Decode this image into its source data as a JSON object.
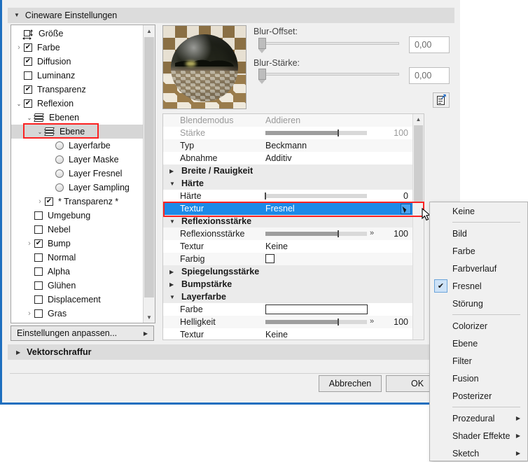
{
  "section": {
    "title": "Cineware Einstellungen",
    "title2": "Vektorschraffur"
  },
  "tree": {
    "items": [
      {
        "label": "Größe",
        "kind": "icon-size",
        "indent": 0,
        "twisty": "none",
        "checked": null
      },
      {
        "label": "Farbe",
        "kind": "checkbox",
        "indent": 0,
        "twisty": "closed",
        "checked": true
      },
      {
        "label": "Diffusion",
        "kind": "checkbox",
        "indent": 0,
        "twisty": "none",
        "checked": true
      },
      {
        "label": "Luminanz",
        "kind": "checkbox",
        "indent": 0,
        "twisty": "none",
        "checked": false
      },
      {
        "label": "Transparenz",
        "kind": "checkbox",
        "indent": 0,
        "twisty": "none",
        "checked": true
      },
      {
        "label": "Reflexion",
        "kind": "checkbox",
        "indent": 0,
        "twisty": "open",
        "checked": true
      },
      {
        "label": "Ebenen",
        "kind": "layers",
        "indent": 1,
        "twisty": "open",
        "checked": null
      },
      {
        "label": "Ebene",
        "kind": "layers",
        "indent": 2,
        "twisty": "open",
        "checked": null,
        "selected": true,
        "highlight": true
      },
      {
        "label": "Layerfarbe",
        "kind": "radio",
        "indent": 3,
        "twisty": "none",
        "checked": null
      },
      {
        "label": "Layer Maske",
        "kind": "radio",
        "indent": 3,
        "twisty": "none",
        "checked": null
      },
      {
        "label": "Layer Fresnel",
        "kind": "radio",
        "indent": 3,
        "twisty": "none",
        "checked": null
      },
      {
        "label": "Layer Sampling",
        "kind": "radio",
        "indent": 3,
        "twisty": "none",
        "checked": null
      },
      {
        "label": "* Transparenz *",
        "kind": "checkbox",
        "indent": 2,
        "twisty": "closed",
        "checked": true
      },
      {
        "label": "Umgebung",
        "kind": "checkbox",
        "indent": 1,
        "twisty": "none",
        "checked": false
      },
      {
        "label": "Nebel",
        "kind": "checkbox",
        "indent": 1,
        "twisty": "none",
        "checked": false
      },
      {
        "label": "Bump",
        "kind": "checkbox",
        "indent": 1,
        "twisty": "closed",
        "checked": true
      },
      {
        "label": "Normal",
        "kind": "checkbox",
        "indent": 1,
        "twisty": "none",
        "checked": false
      },
      {
        "label": "Alpha",
        "kind": "checkbox",
        "indent": 1,
        "twisty": "none",
        "checked": false
      },
      {
        "label": "Glühen",
        "kind": "checkbox",
        "indent": 1,
        "twisty": "none",
        "checked": false
      },
      {
        "label": "Displacement",
        "kind": "checkbox",
        "indent": 1,
        "twisty": "none",
        "checked": false
      },
      {
        "label": "Gras",
        "kind": "checkbox",
        "indent": 1,
        "twisty": "closed",
        "checked": false
      }
    ],
    "adjust_button": "Einstellungen anpassen..."
  },
  "preview": {
    "blur_offset_label": "Blur-Offset:",
    "blur_offset_value": "0,00",
    "blur_strength_label": "Blur-Stärke:",
    "blur_strength_value": "0,00"
  },
  "properties": {
    "rows": [
      {
        "name": "Blendemodus",
        "value": "Addieren",
        "type": "text",
        "style": "dim-alt"
      },
      {
        "name": "Stärke",
        "value": "",
        "type": "slider",
        "num": "100",
        "fill": 72,
        "style": "dim",
        "knob": true
      },
      {
        "name": "Typ",
        "value": "Beckmann",
        "type": "text",
        "style": "alt"
      },
      {
        "name": "Abnahme",
        "value": "Additiv",
        "type": "text",
        "style": "normal"
      },
      {
        "name": "Breite / Rauigkeit",
        "value": "",
        "type": "group",
        "twisty": "closed"
      },
      {
        "name": "Härte",
        "value": "",
        "type": "group",
        "twisty": "open"
      },
      {
        "name": "Härte",
        "value": "",
        "type": "slider",
        "num": "0",
        "fill": 0,
        "style": "normal",
        "knob": true
      },
      {
        "name": "Textur",
        "value": "Fresnel",
        "type": "text",
        "style": "selected",
        "dropdown": true
      },
      {
        "name": "Reflexionsstärke",
        "value": "",
        "type": "group",
        "twisty": "open"
      },
      {
        "name": "Reflexionsstärke",
        "value": "",
        "type": "slider",
        "num": "100",
        "fill": 72,
        "style": "alt",
        "knob": true,
        "arrows": true
      },
      {
        "name": "Textur",
        "value": "Keine",
        "type": "text",
        "style": "normal"
      },
      {
        "name": "Farbig",
        "value": "",
        "type": "checkbox",
        "style": "alt",
        "checked": false
      },
      {
        "name": "Spiegelungsstärke",
        "value": "",
        "type": "group",
        "twisty": "closed"
      },
      {
        "name": "Bumpstärke",
        "value": "",
        "type": "group",
        "twisty": "closed"
      },
      {
        "name": "Layerfarbe",
        "value": "",
        "type": "group",
        "twisty": "open"
      },
      {
        "name": "Farbe",
        "value": "",
        "type": "color",
        "style": "normal"
      },
      {
        "name": "Helligkeit",
        "value": "",
        "type": "slider",
        "num": "100",
        "fill": 72,
        "style": "alt",
        "knob": true,
        "arrows": true
      },
      {
        "name": "Textur",
        "value": "Keine",
        "type": "text",
        "style": "normal"
      }
    ]
  },
  "menu": {
    "items": [
      {
        "label": "Keine",
        "checked": false,
        "submenu": false
      },
      {
        "type": "separator"
      },
      {
        "label": "Bild",
        "checked": false,
        "submenu": false
      },
      {
        "label": "Farbe",
        "checked": false,
        "submenu": false
      },
      {
        "label": "Farbverlauf",
        "checked": false,
        "submenu": false
      },
      {
        "label": "Fresnel",
        "checked": true,
        "submenu": false
      },
      {
        "label": "Störung",
        "checked": false,
        "submenu": false
      },
      {
        "type": "separator"
      },
      {
        "label": "Colorizer",
        "checked": false,
        "submenu": false
      },
      {
        "label": "Ebene",
        "checked": false,
        "submenu": false
      },
      {
        "label": "Filter",
        "checked": false,
        "submenu": false
      },
      {
        "label": "Fusion",
        "checked": false,
        "submenu": false
      },
      {
        "label": "Posterizer",
        "checked": false,
        "submenu": false
      },
      {
        "type": "separator"
      },
      {
        "label": "Prozedural",
        "checked": false,
        "submenu": true
      },
      {
        "label": "Shader Effekte",
        "checked": false,
        "submenu": true
      },
      {
        "label": "Sketch",
        "checked": false,
        "submenu": true
      }
    ]
  },
  "footer": {
    "cancel": "Abbrechen",
    "ok": "OK"
  },
  "colors": {
    "accent": "#1c8ae8",
    "highlight": "#fb2222",
    "dialog_border": "#1e6fbf"
  }
}
